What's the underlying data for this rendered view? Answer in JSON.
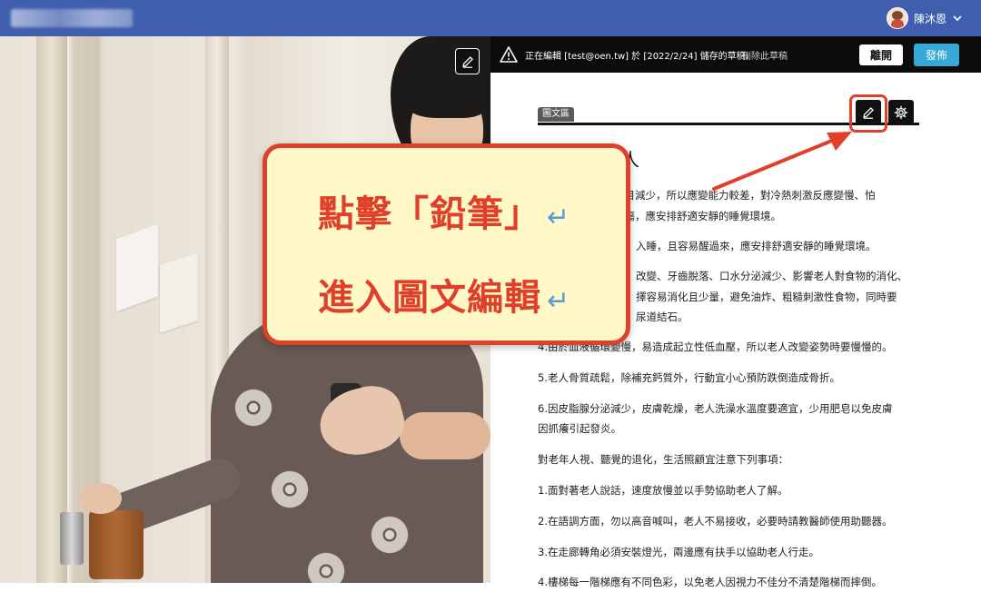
{
  "topbar": {
    "user_name": "陳沐恩"
  },
  "editbar": {
    "editing_text": "正在編輯 [test@oen.tw] 於 [2022/2/24] 儲存的草稿。",
    "delete_draft": "刪除此草稿",
    "leave_label": "離開",
    "publish_label": "發佈"
  },
  "section": {
    "tab_label": "圖文區",
    "heading_fragment": "人"
  },
  "article": {
    "paragraphs": [
      "數目減少，所以應變能力較差，對冷熱刺激反應變慢、怕",
      "燙傷，應安排舒適安靜的睡覺環境。",
      "入睡，且容易醒過來，應安排舒適安靜的睡覺環境。",
      "改變、牙齒脫落、口水分泌減少、影響老人對食物的消化、",
      "擇容易消化且少量，避免油炸、粗糙刺激性食物，同時要",
      "尿道結石。",
      "4.由於血液循環變慢，易造成起立性低血壓，所以老人改變姿勢時要慢慢的。",
      "5.老人骨質疏鬆，除補充鈣質外，行動宜小心預防跌倒造成骨折。",
      "6.因皮脂腺分泌減少，皮膚乾燥，老人洗澡水溫度要適宜，少用肥皂以免皮膚",
      "因抓癢引起發炎。",
      "對老年人視、聽覺的退化，生活照顧宜注意下列事項：",
      "1.面對著老人說話，速度放慢並以手勢協助老人了解。",
      "2.在語調方面，勿以高音喊叫，老人不易接收，必要時請教醫師使用助聽器。",
      "3.在走廊轉角必須安裝燈光，兩邊應有扶手以協助老人行走。",
      "4.樓梯每一階梯應有不同色彩，以免老人因視力不佳分不清楚階梯而摔倒。"
    ]
  },
  "callout": {
    "line1": "點擊「鉛筆」",
    "line2": "進入圖文編輯",
    "return_mark": "↵"
  },
  "colors": {
    "topbar": "#3f5fae",
    "accent_red": "#e0402a",
    "publish_blue": "#36a9d6",
    "callout_bg": "#fff9c8"
  },
  "icons": [
    "avatar",
    "chevron-down-icon",
    "warning-icon",
    "pencil-icon",
    "gear-icon"
  ]
}
